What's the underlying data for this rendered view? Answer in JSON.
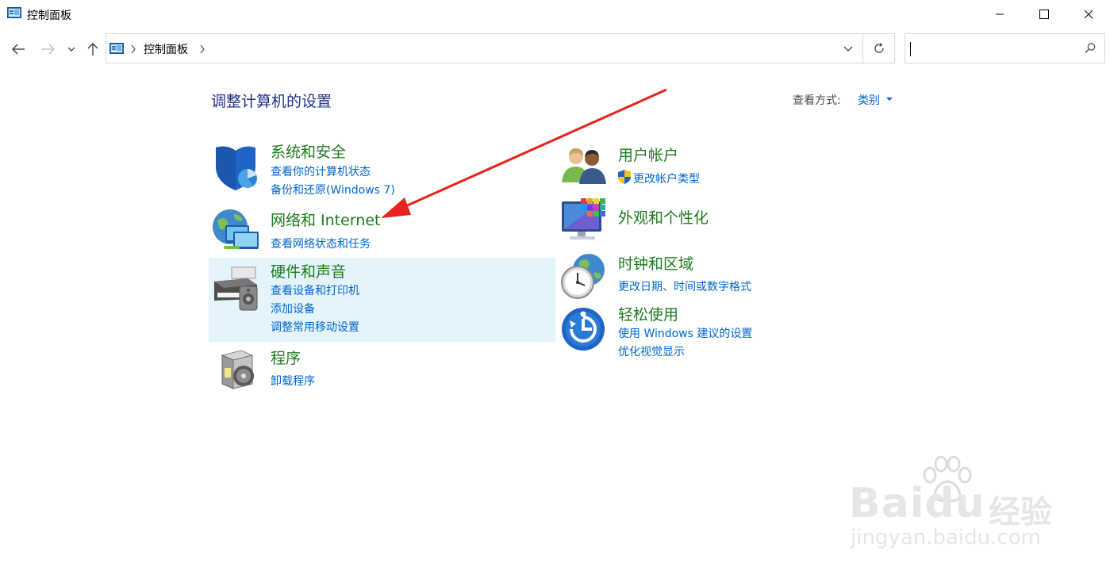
{
  "window": {
    "title": "控制面板"
  },
  "nav": {
    "breadcrumb_root": "控制面板"
  },
  "content": {
    "heading": "调整计算机的设置",
    "view_by_label": "查看方式:",
    "view_by_value": "类别"
  },
  "categories_left": [
    {
      "title": "系统和安全",
      "links": [
        "查看你的计算机状态",
        "备份和还原(Windows 7)"
      ]
    },
    {
      "title": "网络和 Internet",
      "links": [
        "查看网络状态和任务"
      ]
    },
    {
      "title": "硬件和声音",
      "links": [
        "查看设备和打印机",
        "添加设备",
        "调整常用移动设置"
      ]
    },
    {
      "title": "程序",
      "links": [
        "卸载程序"
      ]
    }
  ],
  "categories_right": [
    {
      "title": "用户帐户",
      "links": [
        "更改帐户类型"
      ]
    },
    {
      "title": "外观和个性化",
      "links": []
    },
    {
      "title": "时钟和区域",
      "links": [
        "更改日期、时间或数字格式"
      ]
    },
    {
      "title": "轻松使用",
      "links": [
        "使用 Windows 建议的设置",
        "优化视觉显示"
      ]
    }
  ],
  "watermark": {
    "brand": "Baidu",
    "product": "经验",
    "url": "jingyan.baidu.com"
  },
  "colors": {
    "category_title": "#1e7a1e",
    "link": "#0066cc",
    "heading": "#1e3287",
    "hover_highlight": "#e5f3fb",
    "annotation_arrow": "#e8231b"
  }
}
